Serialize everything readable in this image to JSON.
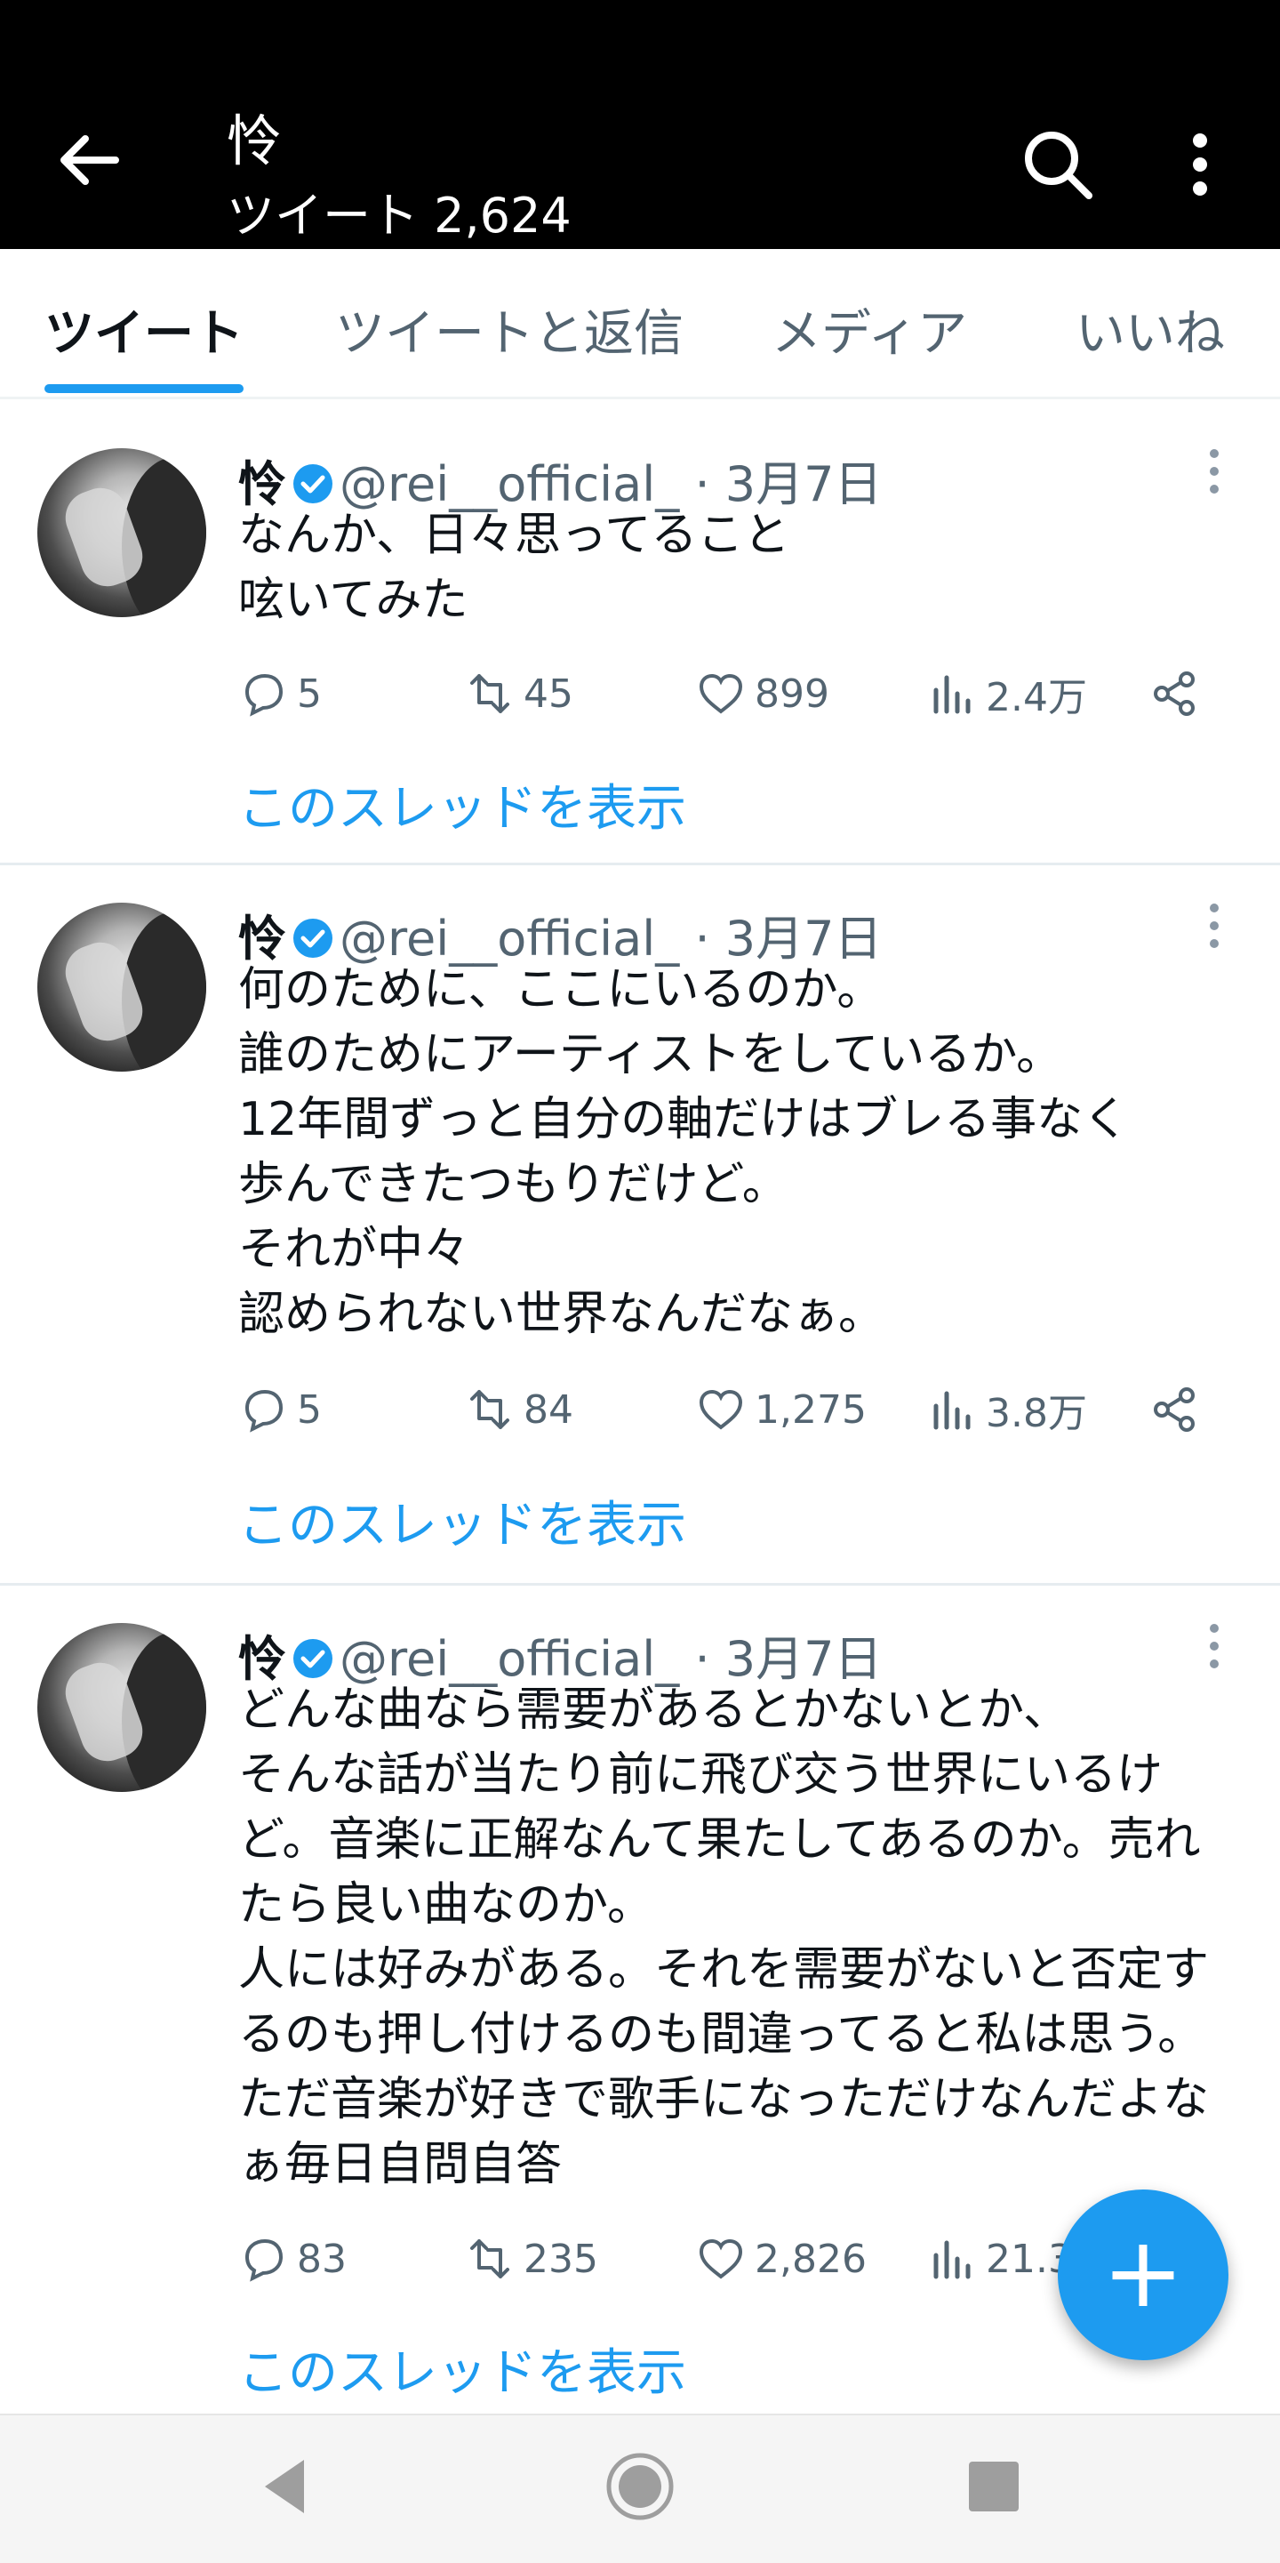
{
  "header": {
    "title": "怜",
    "subtitle": "ツイート 2,624",
    "icons": {
      "back": "back-arrow-icon",
      "search": "search-icon",
      "more": "more-vertical-icon"
    }
  },
  "tabs": [
    {
      "label": "ツイート",
      "active": true
    },
    {
      "label": "ツイートと返信",
      "active": false
    },
    {
      "label": "メディア",
      "active": false
    },
    {
      "label": "いいね",
      "active": false
    }
  ],
  "colors": {
    "accent": "#1d9bf0",
    "header_bg": "#000000",
    "text": "#0f1419",
    "muted": "#536471"
  },
  "tweets": [
    {
      "name": "怜",
      "handle": "@rei__official_",
      "date": "· 3月7日",
      "text": "なんか、日々思ってること\n呟いてみた",
      "replies": "5",
      "retweets": "45",
      "likes": "899",
      "views": "2.4万",
      "thread_link": "このスレッドを表示"
    },
    {
      "name": "怜",
      "handle": "@rei__official_",
      "date": "· 3月7日",
      "text": "何のために、ここにいるのか。\n誰のためにアーティストをしているか。\n12年間ずっと自分の軸だけはブレる事なく\n歩んできたつもりだけど。\nそれが中々\n認められない世界なんだなぁ。",
      "replies": "5",
      "retweets": "84",
      "likes": "1,275",
      "views": "3.8万",
      "thread_link": "このスレッドを表示"
    },
    {
      "name": "怜",
      "handle": "@rei__official_",
      "date": "· 3月7日",
      "text": "どんな曲なら需要があるとかないとか、\nそんな話が当たり前に飛び交う世界にいるけど。音楽に正解なんて果たしてあるのか。売れたら良い曲なのか。\n人には好みがある。それを需要がないと否定するのも押し付けるのも間違ってると私は思う。ただ音楽が好きで歌手になっただけなんだよなぁ毎日自問自答",
      "replies": "83",
      "retweets": "235",
      "likes": "2,826",
      "views": "21.3",
      "thread_link": "このスレッドを表示"
    }
  ],
  "fab": {
    "label": "+",
    "icon": "compose-plus-icon"
  },
  "navbar": {
    "icons": [
      "nav-back-icon",
      "nav-home-icon",
      "nav-recents-icon"
    ]
  }
}
